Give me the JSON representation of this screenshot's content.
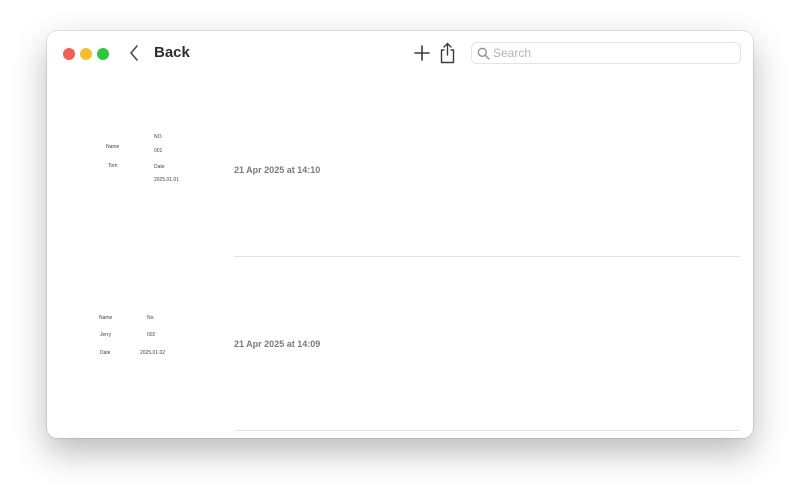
{
  "window": {
    "back_label": "Back"
  },
  "toolbar": {
    "add_icon": "plus-icon",
    "share_icon": "share-icon"
  },
  "search": {
    "placeholder": "Search",
    "value": ""
  },
  "notes": [
    {
      "timestamp": "21 Apr 2025 at 14:10",
      "thumbnail": {
        "name_label": "Name",
        "name_value": "Tom",
        "no_label": "NO.",
        "no_value": "001",
        "date_label": "Date",
        "date_value": "2025.01.01"
      }
    },
    {
      "timestamp": "21 Apr 2025 at 14:09",
      "thumbnail": {
        "name_label": "Name",
        "name_value": "Jerry",
        "no_label": "No.",
        "no_value": "002",
        "date_label": "Date",
        "date_value": "2025.01.02"
      }
    }
  ],
  "colors": {
    "close": "#ee5f57",
    "minimize": "#f6bd2f",
    "maximize": "#2ac840"
  }
}
